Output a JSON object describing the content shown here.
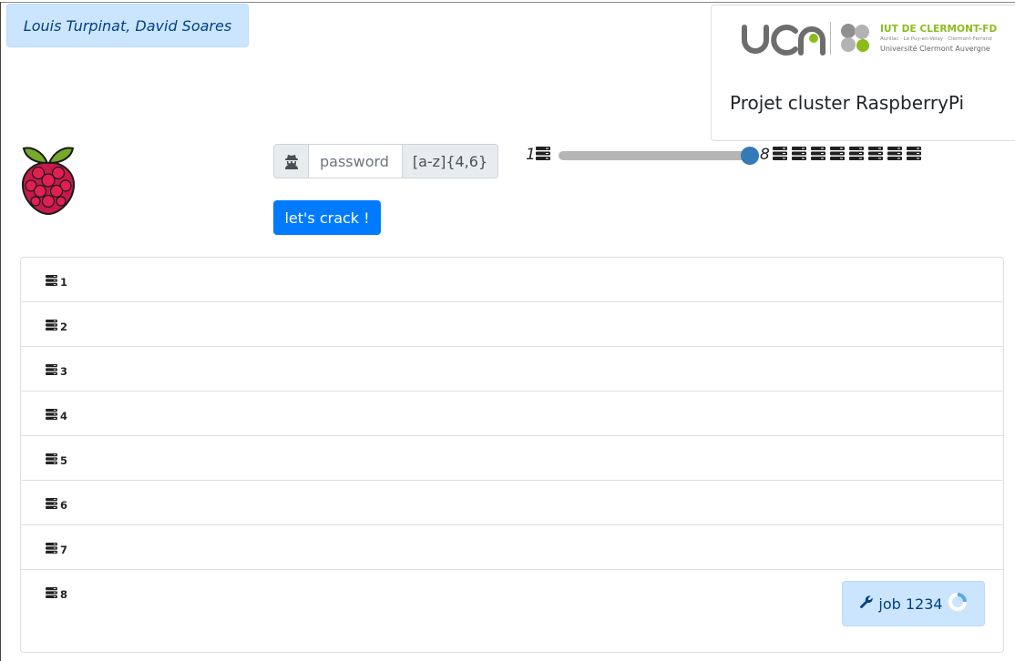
{
  "header": {
    "authors": "Louis Turpinat, David Soares",
    "project_title": "Projet cluster RaspberryPi",
    "iut_logo": {
      "title": "IUT DE CLERMONT-FD",
      "subtitle": "Aurillac · Le Puy-en-Velay · Clermont-Ferrand",
      "university": "Université Clermont Auvergne"
    }
  },
  "form": {
    "password_placeholder": "password",
    "pattern_addon": "[a-z]{4,6}",
    "crack_button": "let's crack !",
    "prepend_icon": "user-secret-icon"
  },
  "slider": {
    "min_label": "1",
    "max_label": "8",
    "value": 8,
    "icon": "server-icon",
    "server_count": 8,
    "thumb_color": "#337ab7"
  },
  "nodes": [
    {
      "label": "1"
    },
    {
      "label": "2"
    },
    {
      "label": "3"
    },
    {
      "label": "4"
    },
    {
      "label": "5"
    },
    {
      "label": "6"
    },
    {
      "label": "7"
    },
    {
      "label": "8"
    }
  ],
  "job": {
    "label": "job 1234",
    "icon": "wrench-icon",
    "status_icon": "spinner-icon"
  },
  "colors": {
    "primary": "#007bff",
    "info_bg": "#cce5ff",
    "info_text": "#004085",
    "raspberry": "#c51a4a",
    "leaf": "#75a928"
  }
}
